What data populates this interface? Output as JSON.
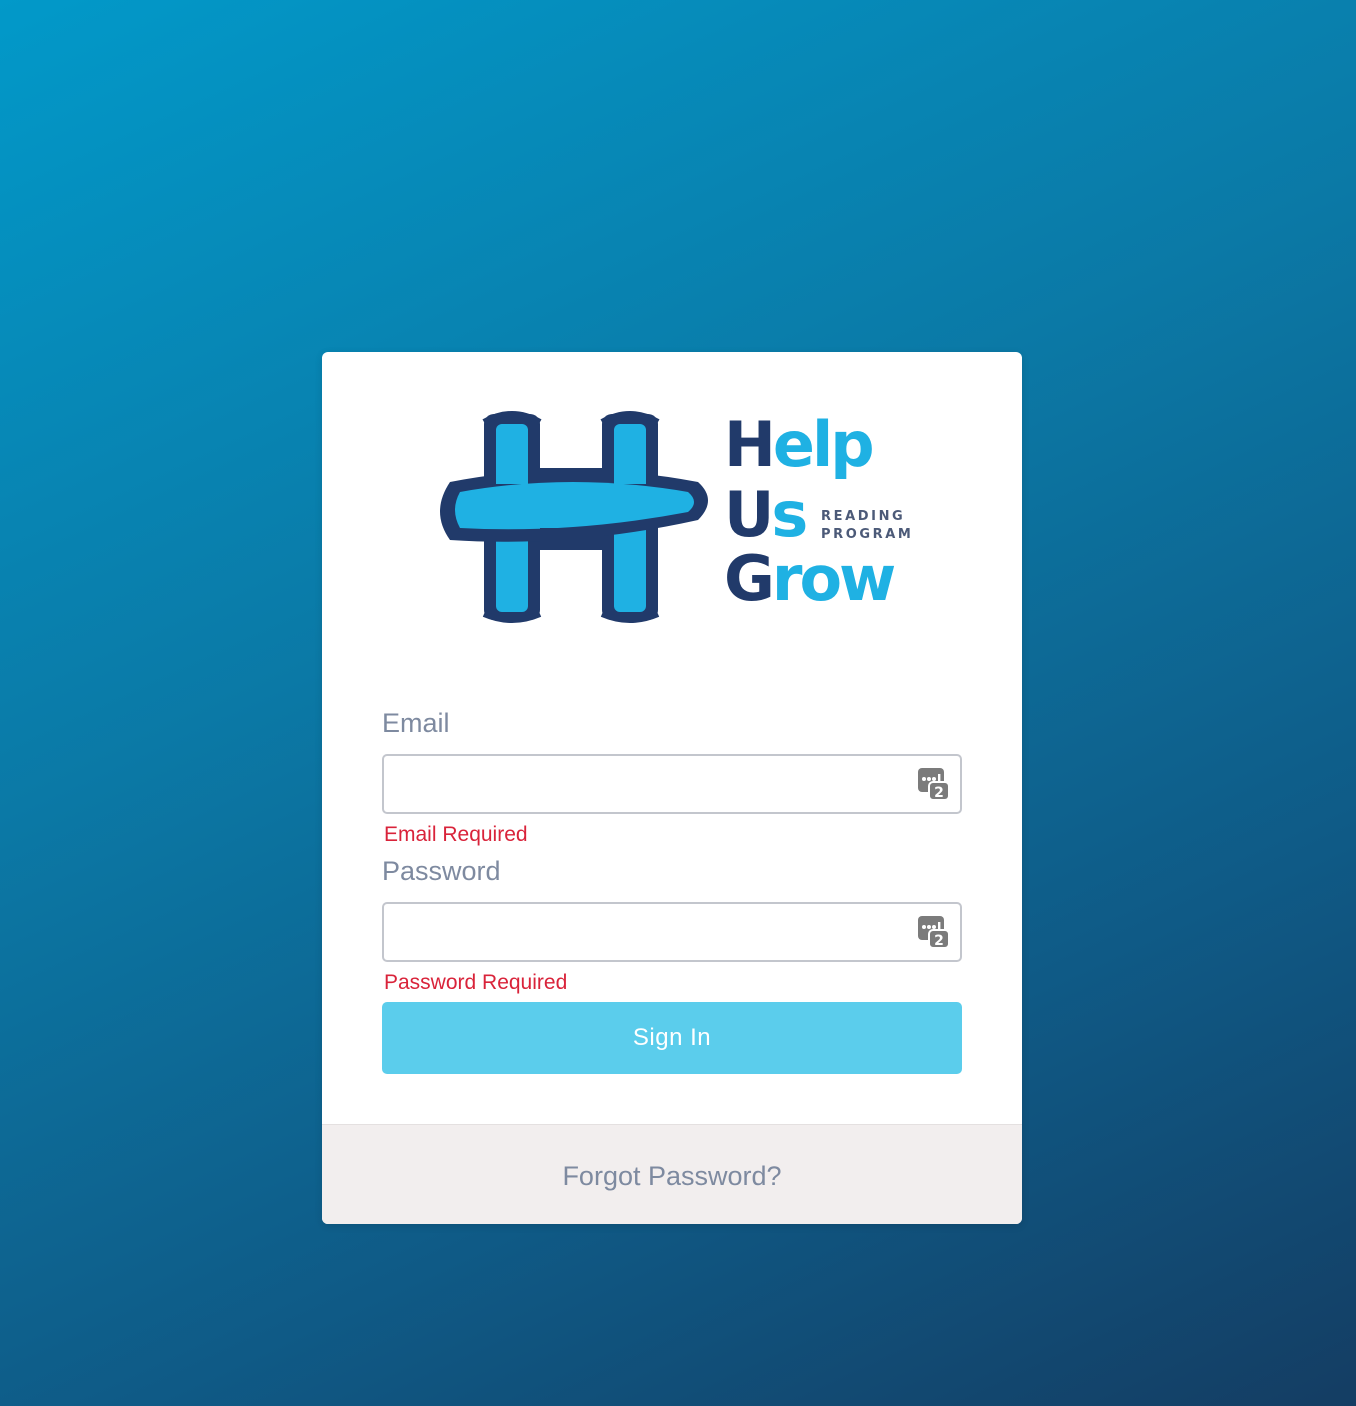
{
  "brand": {
    "logo_word_1_dark": "H",
    "logo_word_1_light": "elp",
    "logo_word_2_dark": "U",
    "logo_word_2_light": "s",
    "logo_word_3_dark": "G",
    "logo_word_3_light": "row",
    "logo_tagline_1": "READING",
    "logo_tagline_2": "PROGRAM",
    "colors": {
      "dark_blue": "#213a6a",
      "light_blue": "#1fb1e3"
    }
  },
  "form": {
    "email": {
      "label": "Email",
      "value": "",
      "placeholder": "",
      "error": "Email Required",
      "icon": "password-manager-icon"
    },
    "password": {
      "label": "Password",
      "value": "",
      "placeholder": "",
      "error": "Password Required",
      "icon": "password-manager-icon"
    },
    "submit_label": "Sign In"
  },
  "footer": {
    "forgot_label": "Forgot Password?"
  },
  "colors": {
    "background_start": "#0299c9",
    "background_end": "#143d63",
    "button": "#5bcdec",
    "error": "#d9233a",
    "label": "#7e8aa0",
    "footer_bg": "#f2eeee"
  }
}
